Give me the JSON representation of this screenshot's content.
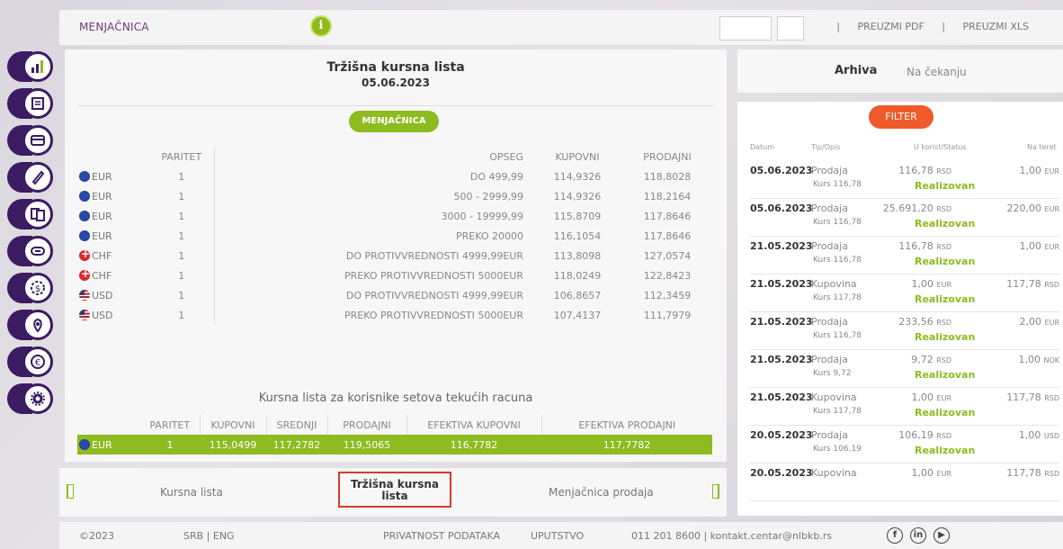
{
  "topbar": {
    "title": "MENJAČNICA",
    "info_icon": "i",
    "sep1": "|",
    "pdf": "PREUZMI PDF",
    "sep2": "|",
    "xls": "PREUZMI XLS"
  },
  "sidebar": {
    "icons": [
      "bar-chart-icon",
      "document-icon",
      "card-icon",
      "pen-icon",
      "exchange-icon",
      "minus-card-icon",
      "coin-icon",
      "location-icon",
      "euro-icon",
      "gear-icon"
    ]
  },
  "main": {
    "title": "Tržišna kursna lista",
    "date": "05.06.2023",
    "pill": "MENJAČNICA",
    "headers": [
      "PARITET",
      "OPSEG",
      "KUPOVNI",
      "PRODAJNI"
    ],
    "rows": [
      {
        "flag": "eu",
        "cur": "EUR",
        "par": "1",
        "range": "DO 499,99",
        "buy": "114,9326",
        "sell": "118,8028"
      },
      {
        "flag": "eu",
        "cur": "EUR",
        "par": "1",
        "range": "500 - 2999,99",
        "buy": "114,9326",
        "sell": "118,2164"
      },
      {
        "flag": "eu",
        "cur": "EUR",
        "par": "1",
        "range": "3000 - 19999,99",
        "buy": "115,8709",
        "sell": "117,8646"
      },
      {
        "flag": "eu",
        "cur": "EUR",
        "par": "1",
        "range": "PREKO 20000",
        "buy": "116,1054",
        "sell": "117,8646"
      },
      {
        "flag": "ch",
        "cur": "CHF",
        "par": "1",
        "range": "DO PROTIVVREDNOSTI 4999,99EUR",
        "buy": "113,8098",
        "sell": "127,0574"
      },
      {
        "flag": "ch",
        "cur": "CHF",
        "par": "1",
        "range": "PREKO PROTIVVREDNOSTI 5000EUR",
        "buy": "118,0249",
        "sell": "122,8423"
      },
      {
        "flag": "us",
        "cur": "USD",
        "par": "1",
        "range": "DO PROTIVVREDNOSTI 4999,99EUR",
        "buy": "106,8657",
        "sell": "112,3459"
      },
      {
        "flag": "us",
        "cur": "USD",
        "par": "1",
        "range": "PREKO PROTIVVREDNOSTI 5000EUR",
        "buy": "107,4137",
        "sell": "111,7979"
      }
    ],
    "subtitle2": "Kursna lista za korisnike setova tekućih racuna",
    "corp_headers": [
      "PARITET",
      "KUPOVNI",
      "SREDNJI",
      "PRODAJNI",
      "EFEKTIVA KUPOVNI",
      "EFEKTIVA PRODAJNI"
    ],
    "corp_row": {
      "cur": "EUR",
      "par": "1",
      "buy": "115,0499",
      "mid": "117,2782",
      "sell": "119,5065",
      "ebuy": "116,7782",
      "esell": "117,7782"
    }
  },
  "bottom": {
    "left": "Kursna lista",
    "active": "Tržišna kursna lista",
    "right": "Menjačnica prodaja"
  },
  "archive": {
    "tab1": "Arhiva",
    "tab2": "Na čekanju",
    "filter": "FILTER",
    "cols": [
      "Datum",
      "Tip/Opis",
      "U korist/Status",
      "Na teret"
    ],
    "items": [
      {
        "date": "05.06.2023",
        "type": "Prodaja",
        "kurs": "Kurs 116,78",
        "amt": "116,78",
        "amt_cur": "RSD",
        "status": "Realizovan",
        "debit": "1,00",
        "debit_cur": "EUR"
      },
      {
        "date": "05.06.2023",
        "type": "Prodaja",
        "kurs": "Kurs 116,78",
        "amt": "25.691,20",
        "amt_cur": "RSD",
        "status": "Realizovan",
        "debit": "220,00",
        "debit_cur": "EUR"
      },
      {
        "date": "21.05.2023",
        "type": "Prodaja",
        "kurs": "Kurs 116,78",
        "amt": "116,78",
        "amt_cur": "RSD",
        "status": "Realizovan",
        "debit": "1,00",
        "debit_cur": "EUR"
      },
      {
        "date": "21.05.2023",
        "type": "Kupovina",
        "kurs": "Kurs 117,78",
        "amt": "1,00",
        "amt_cur": "EUR",
        "status": "Realizovan",
        "debit": "117,78",
        "debit_cur": "RSD"
      },
      {
        "date": "21.05.2023",
        "type": "Prodaja",
        "kurs": "Kurs 116,78",
        "amt": "233,56",
        "amt_cur": "RSD",
        "status": "Realizovan",
        "debit": "2,00",
        "debit_cur": "EUR"
      },
      {
        "date": "21.05.2023",
        "type": "Prodaja",
        "kurs": "Kurs 9,72",
        "amt": "9,72",
        "amt_cur": "RSD",
        "status": "Realizovan",
        "debit": "1,00",
        "debit_cur": "NOK"
      },
      {
        "date": "21.05.2023",
        "type": "Kupovina",
        "kurs": "Kurs 117,78",
        "amt": "1,00",
        "amt_cur": "EUR",
        "status": "Realizovan",
        "debit": "117,78",
        "debit_cur": "RSD"
      },
      {
        "date": "20.05.2023",
        "type": "Prodaja",
        "kurs": "Kurs 106,19",
        "amt": "106,19",
        "amt_cur": "RSD",
        "status": "Realizovan",
        "debit": "1,00",
        "debit_cur": "USD"
      },
      {
        "date": "20.05.2023",
        "type": "Kupovina",
        "kurs": "",
        "amt": "1,00",
        "amt_cur": "EUR",
        "status": "",
        "debit": "117,78",
        "debit_cur": "RSD"
      }
    ]
  },
  "footer": {
    "copy": "©2023",
    "lang": "SRB | ENG",
    "privacy": "PRIVATNOST PODATAKA",
    "guide": "UPUTSTVO",
    "contact": "011 201 8600 | kontakt.centar@nlbkb.rs",
    "social": [
      "facebook-icon",
      "linkedin-icon",
      "youtube-icon"
    ]
  },
  "colors": {
    "accent": "#8dbb20",
    "brand": "#3b1c63",
    "filter": "#ef5a2a",
    "highlight": "#d43a2f"
  }
}
